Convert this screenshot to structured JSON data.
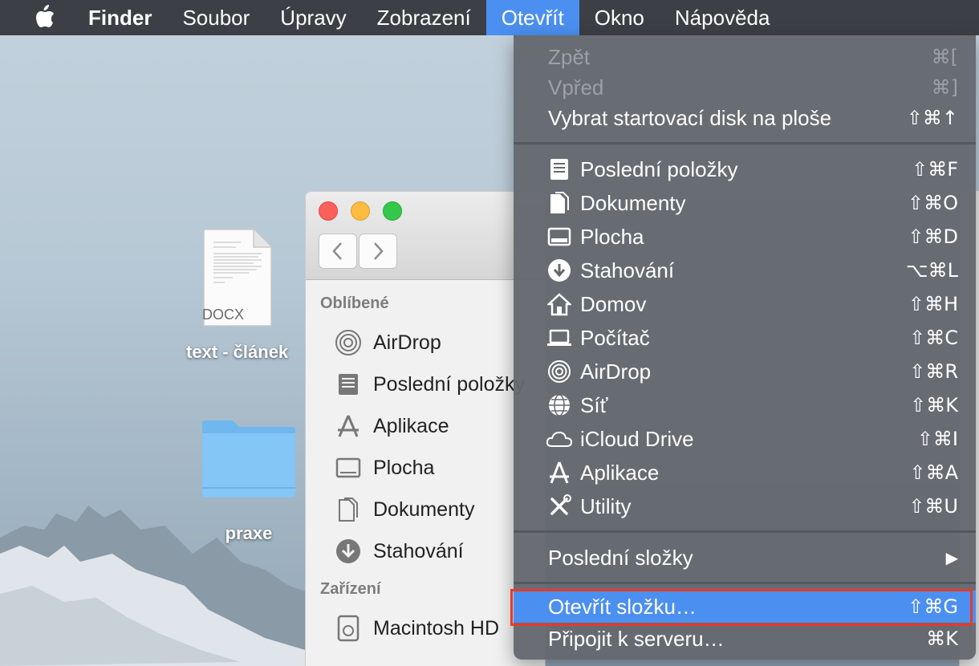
{
  "menubar": {
    "app_name": "Finder",
    "items": [
      "Soubor",
      "Úpravy",
      "Zobrazení",
      "Otevřít",
      "Okno",
      "Nápověda"
    ],
    "active": "Otevřít"
  },
  "desktop": {
    "icons": [
      {
        "label": "text - článek",
        "type_badge": "DOCX"
      },
      {
        "label": "praxe"
      }
    ]
  },
  "finder": {
    "sections": [
      {
        "title": "Oblíbené",
        "items": [
          "AirDrop",
          "Poslední položky",
          "Aplikace",
          "Plocha",
          "Dokumenty",
          "Stahování"
        ]
      },
      {
        "title": "Zařízení",
        "items": [
          "Macintosh HD"
        ]
      }
    ]
  },
  "menu": {
    "top": [
      {
        "label": "Zpět",
        "shortcut": "⌘[",
        "disabled": true
      },
      {
        "label": "Vpřed",
        "shortcut": "⌘]",
        "disabled": true
      },
      {
        "label": "Vybrat startovací disk na ploše",
        "shortcut": "⇧⌘↑",
        "disabled": false
      }
    ],
    "places": [
      {
        "label": "Poslední položky",
        "shortcut": "⇧⌘F",
        "icon": "recents-icon"
      },
      {
        "label": "Dokumenty",
        "shortcut": "⇧⌘O",
        "icon": "documents-icon"
      },
      {
        "label": "Plocha",
        "shortcut": "⇧⌘D",
        "icon": "desktop-icon"
      },
      {
        "label": "Stahování",
        "shortcut": "⌥⌘L",
        "icon": "downloads-icon"
      },
      {
        "label": "Domov",
        "shortcut": "⇧⌘H",
        "icon": "home-icon"
      },
      {
        "label": "Počítač",
        "shortcut": "⇧⌘C",
        "icon": "computer-icon"
      },
      {
        "label": "AirDrop",
        "shortcut": "⇧⌘R",
        "icon": "airdrop-icon"
      },
      {
        "label": "Síť",
        "shortcut": "⇧⌘K",
        "icon": "network-icon"
      },
      {
        "label": "iCloud Drive",
        "shortcut": "⇧⌘I",
        "icon": "icloud-icon"
      },
      {
        "label": "Aplikace",
        "shortcut": "⇧⌘A",
        "icon": "applications-icon"
      },
      {
        "label": "Utility",
        "shortcut": "⇧⌘U",
        "icon": "utilities-icon"
      }
    ],
    "recent_folders": {
      "label": "Poslední složky",
      "shortcut": "▶"
    },
    "bottom": [
      {
        "label": "Otevřít složku…",
        "shortcut": "⇧⌘G",
        "highlighted": true
      },
      {
        "label": "Připojit k serveru…",
        "shortcut": "⌘K",
        "highlighted": false
      }
    ]
  },
  "colors": {
    "menubar": "#3c3f45",
    "accent": "#4b8ff0",
    "annotation": "#e8392a"
  }
}
